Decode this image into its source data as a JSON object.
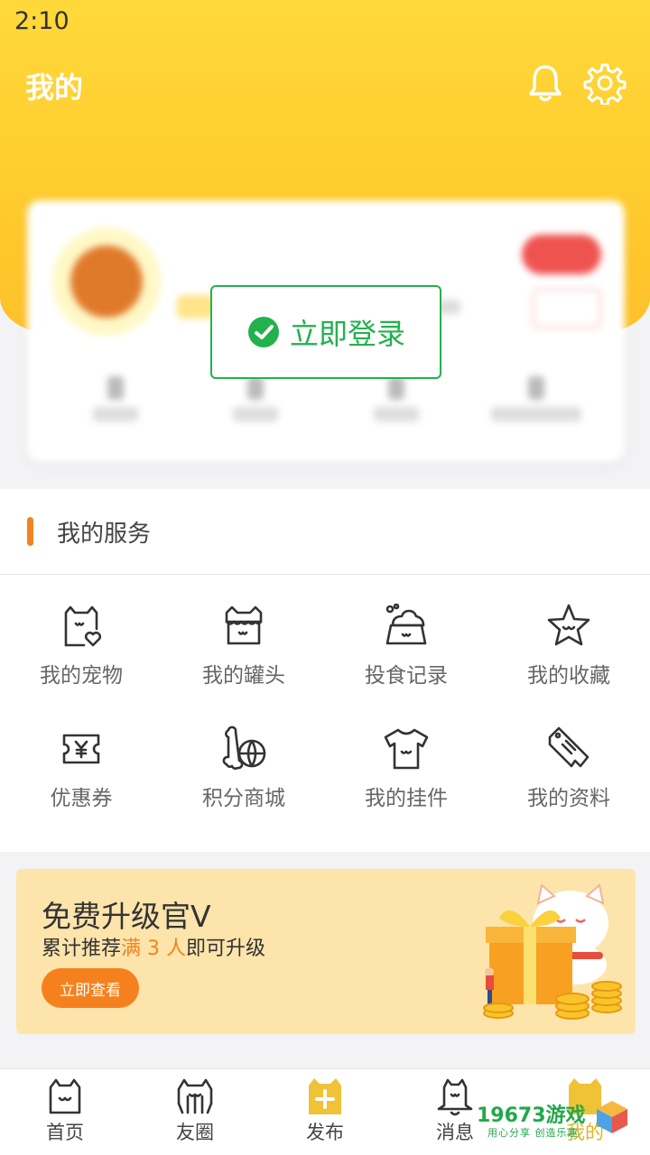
{
  "status": {
    "time": "2:10"
  },
  "header": {
    "title": "我的",
    "icons": [
      "bell-icon",
      "gear-icon"
    ]
  },
  "login": {
    "label": "立即登录",
    "icon": "wechat-icon",
    "color": "#23b14d"
  },
  "services": {
    "title": "我的服务",
    "accent": "#f58220",
    "items": [
      {
        "label": "我的宠物",
        "icon": "pet-heart-icon"
      },
      {
        "label": "我的罐头",
        "icon": "can-icon"
      },
      {
        "label": "投食记录",
        "icon": "feeding-bowl-icon"
      },
      {
        "label": "我的收藏",
        "icon": "star-icon"
      },
      {
        "label": "优惠券",
        "icon": "coupon-icon"
      },
      {
        "label": "积分商城",
        "icon": "points-mall-icon"
      },
      {
        "label": "我的挂件",
        "icon": "shirt-icon"
      },
      {
        "label": "我的资料",
        "icon": "profile-tag-icon"
      }
    ]
  },
  "banner": {
    "title": "免费升级官V",
    "sub_prefix": "累计推荐",
    "sub_highlight": "满 3 人",
    "sub_suffix": "即可升级",
    "button": "立即查看",
    "art": "lucky-cat-gift-illustration"
  },
  "nav": {
    "items": [
      {
        "label": "首页",
        "icon": "home-cat-icon"
      },
      {
        "label": "友圈",
        "icon": "friends-icon"
      },
      {
        "label": "发布",
        "icon": "publish-plus-icon"
      },
      {
        "label": "消息",
        "icon": "message-bell-icon"
      },
      {
        "label": "我的",
        "icon": "me-cat-icon",
        "active": true
      }
    ]
  },
  "watermark": {
    "brand": "19673游戏",
    "tagline": "用心分享 创造乐趣"
  }
}
